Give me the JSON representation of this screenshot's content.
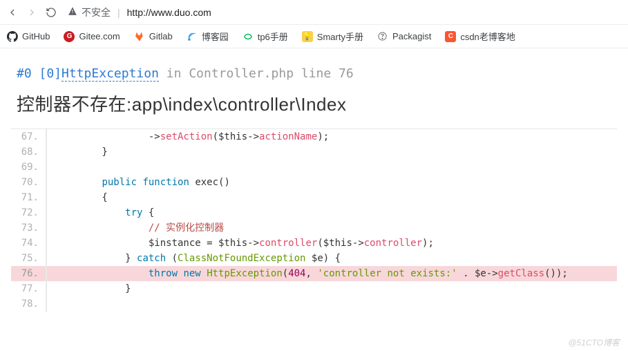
{
  "chrome": {
    "insecure_label": "不安全",
    "url": "http://www.duo.com"
  },
  "bookmarks": [
    {
      "icon": "github-icon",
      "label": "GitHub"
    },
    {
      "icon": "gitee-icon",
      "label": "Gitee.com"
    },
    {
      "icon": "gitlab-icon",
      "label": "Gitlab"
    },
    {
      "icon": "cnblogs-icon",
      "label": "博客园"
    },
    {
      "icon": "tp6-icon",
      "label": "tp6手册"
    },
    {
      "icon": "smarty-icon",
      "label": "Smarty手册"
    },
    {
      "icon": "packagist-icon",
      "label": "Packagist"
    },
    {
      "icon": "csdn-icon",
      "label": "csdn老博客地"
    }
  ],
  "error": {
    "trace_prefix": "#0",
    "trace_bracket": "[0]",
    "exception": "HttpException",
    "in": "in",
    "file": "Controller.php line 76",
    "title": "控制器不存在:app\\index\\controller\\Index"
  },
  "code": {
    "lines": [
      {
        "n": "67.",
        "html": "                ->setAction($this->actionName);"
      },
      {
        "n": "68.",
        "html": "        }"
      },
      {
        "n": "69.",
        "html": ""
      },
      {
        "n": "70.",
        "html": "        public function exec()"
      },
      {
        "n": "71.",
        "html": "        {"
      },
      {
        "n": "72.",
        "html": "            try {"
      },
      {
        "n": "73.",
        "html": "                // 实例化控制器"
      },
      {
        "n": "74.",
        "html": "                $instance = $this->controller($this->controller);"
      },
      {
        "n": "75.",
        "html": "            } catch (ClassNotFoundException $e) {"
      },
      {
        "n": "76.",
        "html": "                throw new HttpException(404, 'controller not exists:' . $e->getClass());",
        "hl": true
      },
      {
        "n": "77.",
        "html": "            }"
      },
      {
        "n": "78.",
        "html": ""
      }
    ]
  },
  "watermark": "@51CTO博客"
}
